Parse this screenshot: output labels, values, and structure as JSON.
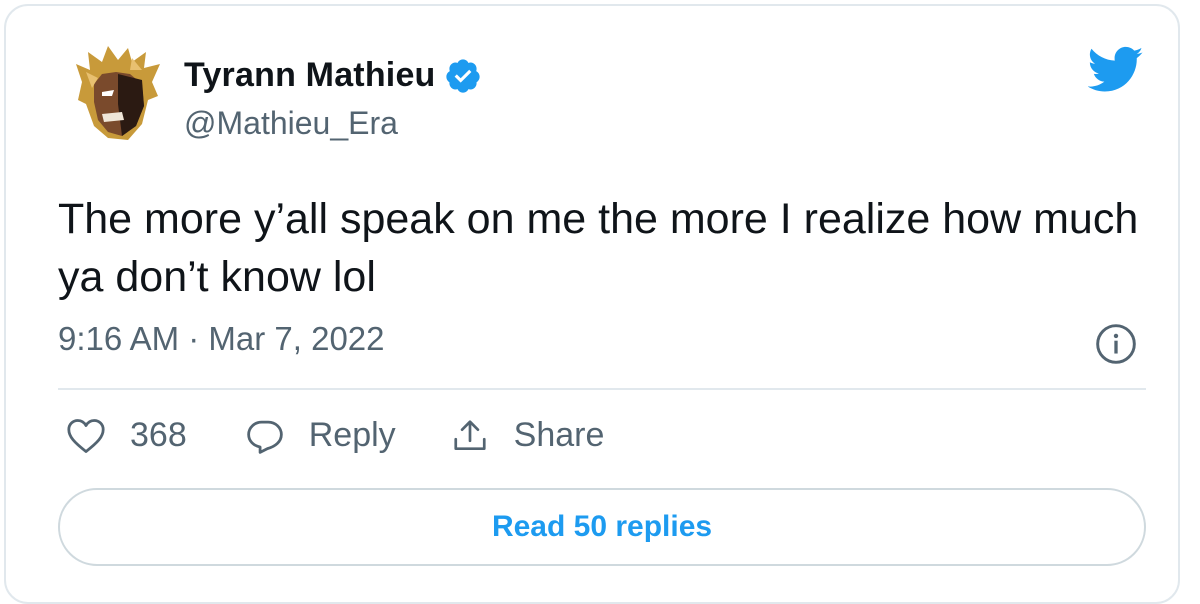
{
  "author": {
    "name": "Tyrann Mathieu",
    "handle": "@Mathieu_Era",
    "verified": true
  },
  "tweet": {
    "text": "The more y’all speak on me the more I realize how much ya don’t know lol",
    "timestamp": "9:16 AM · Mar 7, 2022"
  },
  "actions": {
    "like_count": "368",
    "reply_label": "Reply",
    "share_label": "Share"
  },
  "footer": {
    "read_replies_label": "Read 50 replies"
  },
  "icons": {
    "brand": "twitter-bird-icon",
    "verified": "verified-badge-icon",
    "info": "info-icon",
    "like": "heart-icon",
    "reply": "speech-bubble-icon",
    "share": "share-upload-icon"
  },
  "colors": {
    "accent": "#1d9bf0",
    "text": "#0f1419",
    "secondary_text": "#536471",
    "border": "#e1e8ed"
  }
}
